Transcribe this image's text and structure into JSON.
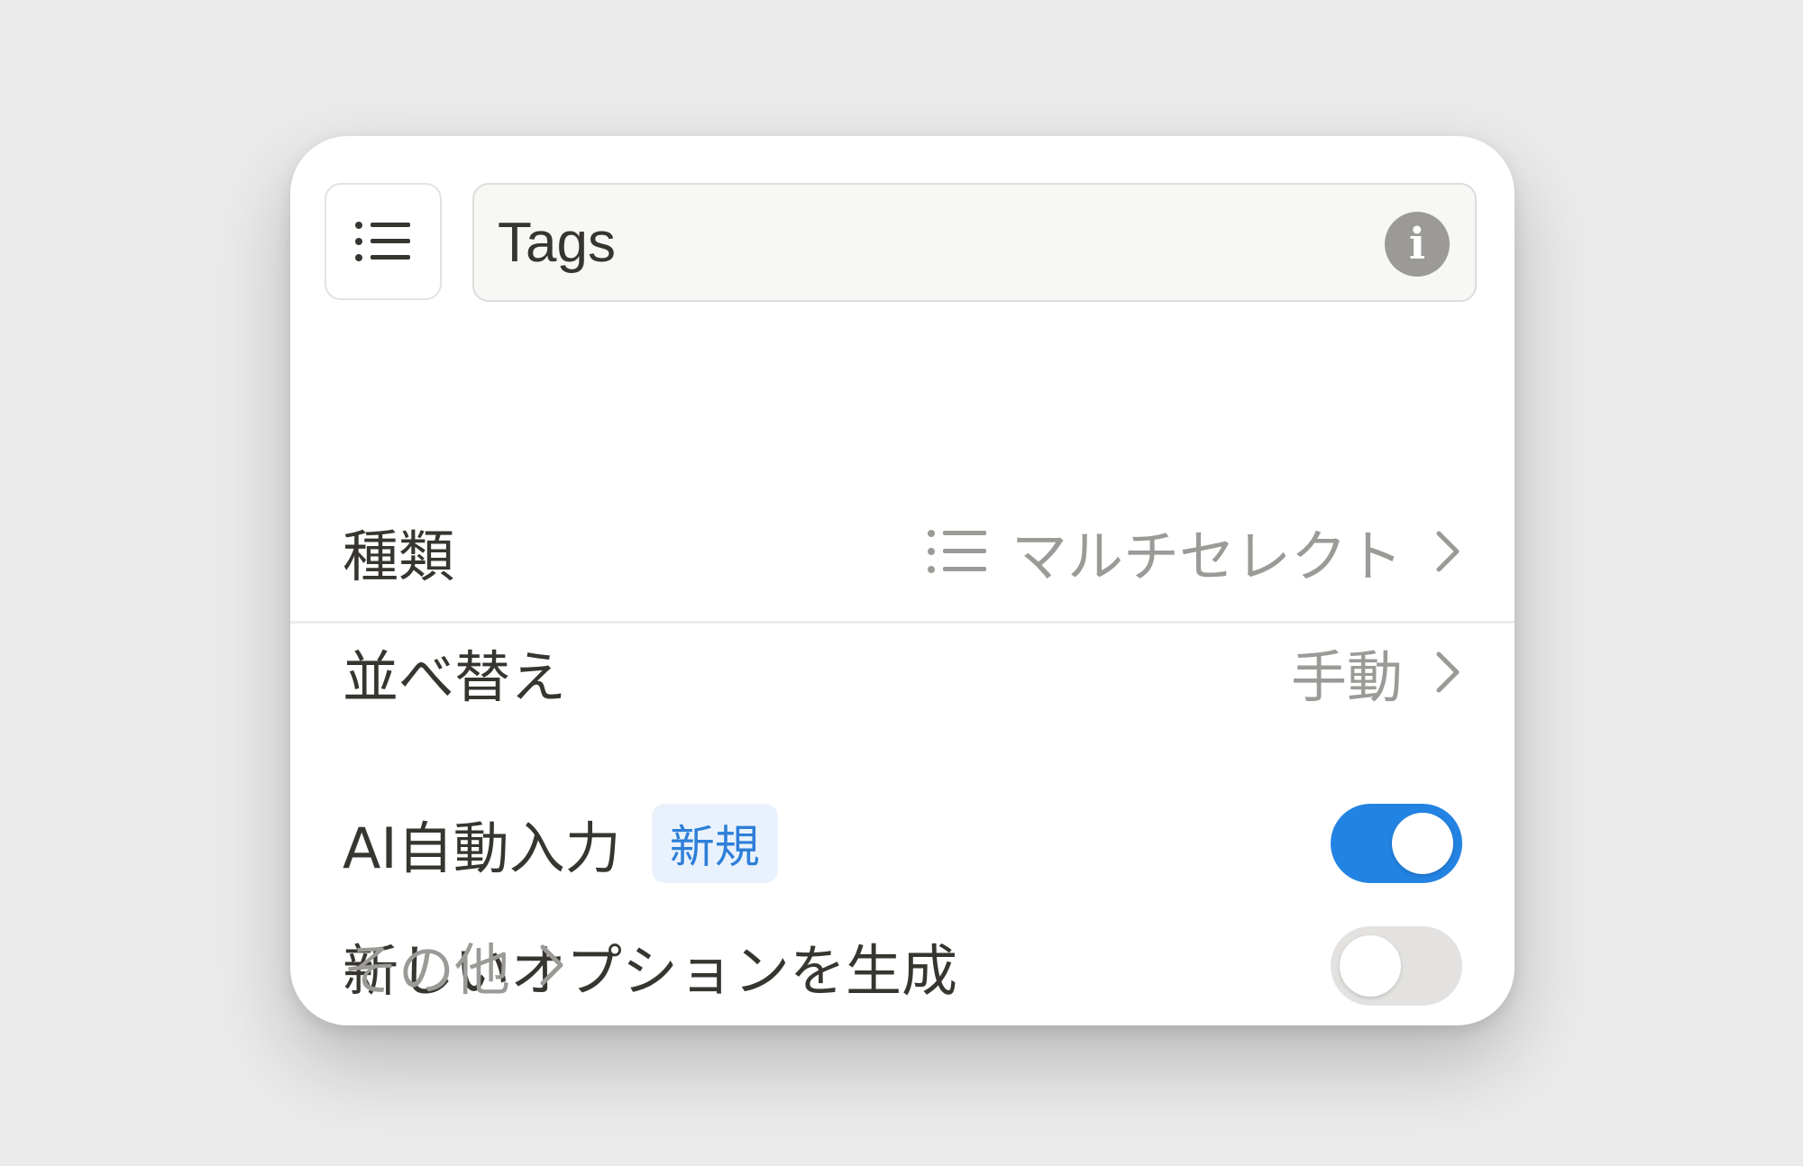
{
  "header": {
    "type_icon": "list-icon",
    "name_value": "Tags",
    "info_icon": "info-icon",
    "info_glyph": "i"
  },
  "rows": {
    "type": {
      "label": "種類",
      "value": "マルチセレクト",
      "value_icon": "list-icon"
    },
    "sort": {
      "label": "並べ替え",
      "value": "手動"
    }
  },
  "ai_autofill": {
    "label": "AI自動入力",
    "badge": "新規",
    "enabled": true
  },
  "generate_options": {
    "label": "新しいオプションを生成",
    "enabled": false
  },
  "more": {
    "label": "その他"
  },
  "colors": {
    "accent": "#2383e2",
    "badge_bg": "#e9f2fc",
    "badge_text": "#2e7fd9",
    "muted_text": "#9b9a97",
    "text": "#37352f"
  }
}
